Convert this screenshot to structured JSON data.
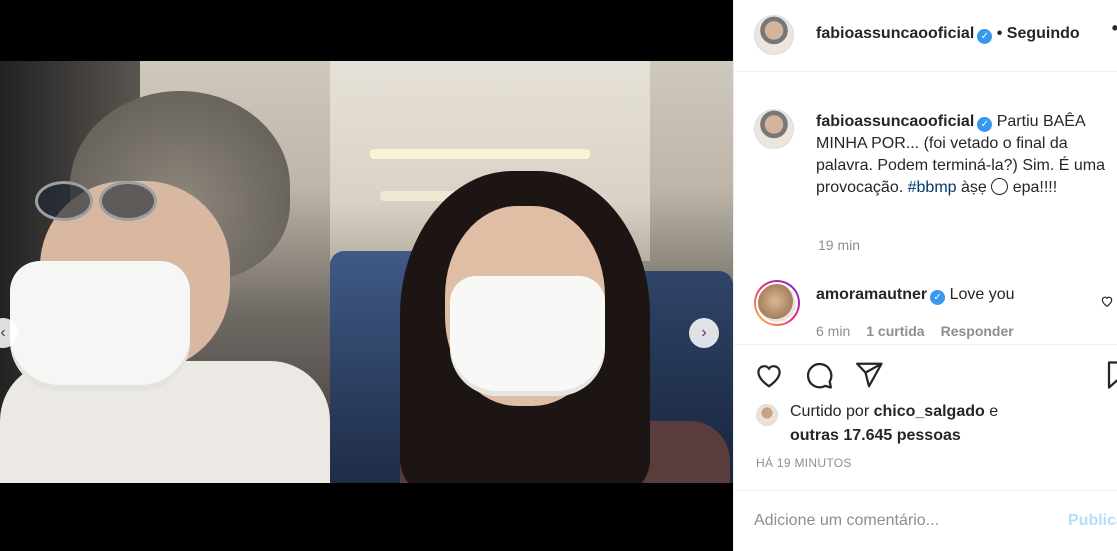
{
  "post": {
    "author": "fabioassuncaooficial",
    "follow_status": "• Seguindo",
    "more": "•",
    "caption_text": "Partiu BAÊA MINHA POR... (foi vetado o final da palavra. Podem terminá-la?) Sim. É uma provocação.",
    "caption_hashtag": "#bbmp",
    "caption_after": "àṣẹ",
    "caption_end": "epa!!!!",
    "caption_time": "19 min",
    "carousel": {
      "total": 5,
      "active_index": 3
    }
  },
  "comment": {
    "author": "amoramautner",
    "text": "Love you",
    "time": "6 min",
    "likes": "1 curtida",
    "reply": "Responder"
  },
  "likes": {
    "prefix": "Curtido por",
    "user": "chico_salgado",
    "joiner": "e",
    "others": "outras 17.645 pessoas"
  },
  "timestamp": "HÁ 19 MINUTOS",
  "add_comment": {
    "placeholder": "Adicione um comentário...",
    "publish": "Publicar"
  },
  "colors": {
    "verified": "#3897f0",
    "hashtag": "#00376b",
    "muted": "#8e8e8e",
    "publish_disabled": "#b2dffc"
  },
  "icons": {
    "like": "heart-icon",
    "comment": "comment-icon",
    "share": "paper-plane-icon",
    "save": "bookmark-icon",
    "prev": "chevron-left-icon",
    "next": "chevron-right-icon"
  }
}
